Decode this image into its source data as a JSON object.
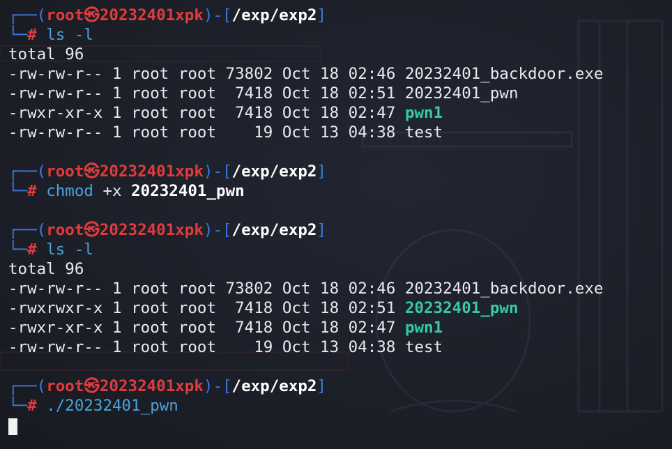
{
  "prompt": {
    "user": "root",
    "skull": "㉿",
    "host": "20232401xpk",
    "path": "/exp/exp2",
    "hash": "#"
  },
  "blocks": [
    {
      "command": "ls",
      "args": " -l",
      "output": [
        {
          "text": "total 96",
          "exec": ""
        },
        {
          "text": "-rw-rw-r-- 1 root root 73802 Oct 18 02:46 20232401_backdoor.exe",
          "exec": ""
        },
        {
          "text": "-rw-rw-r-- 1 root root  7418 Oct 18 02:51 20232401_pwn",
          "exec": ""
        },
        {
          "text": "-rwxr-xr-x 1 root root  7418 Oct 18 02:47 ",
          "exec": "pwn1"
        },
        {
          "text": "-rw-rw-r-- 1 root root    19 Oct 13 04:38 test",
          "exec": ""
        }
      ]
    },
    {
      "command": "chmod",
      "args": " +x ",
      "argb": "20232401_pwn",
      "output": []
    },
    {
      "command": "ls",
      "args": " -l",
      "output": [
        {
          "text": "total 96",
          "exec": ""
        },
        {
          "text": "-rw-rw-r-- 1 root root 73802 Oct 18 02:46 20232401_backdoor.exe",
          "exec": ""
        },
        {
          "text": "-rwxrwxr-x 1 root root  7418 Oct 18 02:51 ",
          "exec": "20232401_pwn"
        },
        {
          "text": "-rwxr-xr-x 1 root root  7418 Oct 18 02:47 ",
          "exec": "pwn1"
        },
        {
          "text": "-rw-rw-r-- 1 root root    19 Oct 13 04:38 test",
          "exec": ""
        }
      ]
    },
    {
      "command": "./20232401_pwn",
      "args": "",
      "output": []
    }
  ],
  "colors": {
    "background": "#1d2029",
    "frame": "#3b78e0",
    "prompt_red": "#e23b3b",
    "command_blue": "#4aa3d8",
    "executable_green": "#36c9a6",
    "text": "#e8eaef"
  }
}
